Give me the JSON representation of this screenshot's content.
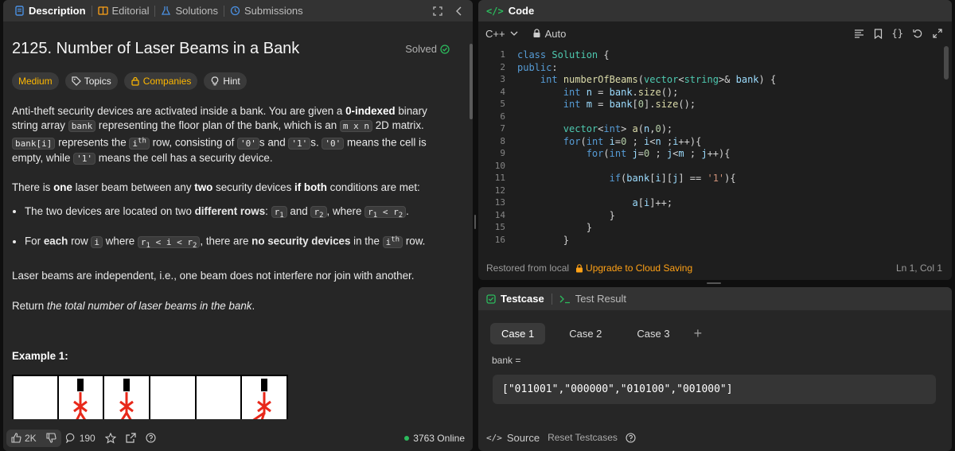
{
  "left_tabs": [
    {
      "label": "Description",
      "icon": "document-icon"
    },
    {
      "label": "Editorial",
      "icon": "book-icon"
    },
    {
      "label": "Solutions",
      "icon": "flask-icon"
    },
    {
      "label": "Submissions",
      "icon": "history-icon"
    }
  ],
  "problem": {
    "title": "2125. Number of Laser Beams in a Bank",
    "solved_label": "Solved",
    "tags": {
      "difficulty": "Medium",
      "topics": "Topics",
      "companies": "Companies",
      "hint": "Hint"
    },
    "p1": {
      "a": "Anti-theft security devices are activated inside a bank. You are given a ",
      "b": "0-indexed",
      "c": " binary string array ",
      "code1": "bank",
      "d": " representing the floor plan of the bank, which is an ",
      "code2": "m x n",
      "e": " 2D matrix. ",
      "code3": "bank[i]",
      "f": " represents the ",
      "code4": "i",
      "code4sup": "th",
      "g": " row, consisting of ",
      "code5": "'0'",
      "h": "s and ",
      "code6": "'1'",
      "i": "s. ",
      "code7": "'0'",
      "j": " means the cell is empty, while ",
      "code8": "'1'",
      "k": " means the cell has a security device."
    },
    "p2": {
      "a": "There is ",
      "b": "one",
      "c": " laser beam between any ",
      "d": "two",
      "e": " security devices ",
      "f": "if both",
      "g": " conditions are met:"
    },
    "cond1": {
      "a": "The two devices are located on two ",
      "b": "different rows",
      "c": ": ",
      "r1": "r",
      "s1": "1",
      "and": " and ",
      "r2": "r",
      "s2": "2",
      "where": ", where ",
      "r1b": "r",
      "s1b": "1",
      "lt": " < r",
      "s2b": "2",
      "end": "."
    },
    "cond2": {
      "a": "For ",
      "b": "each",
      "c": " row ",
      "code_i": "i",
      "d": " where ",
      "r1": "r",
      "s1": "1",
      "mid": " < i < r",
      "s2": "2",
      "e": ", there are ",
      "f": "no security devices",
      "g": " in the ",
      "code_ith": "i",
      "code_ith_sup": "th",
      "h": " row."
    },
    "p3": "Laser beams are independent, i.e., one beam does not interfere nor join with another.",
    "p4": {
      "a": "Return ",
      "b": "the total number of laser beams in the bank",
      "c": "."
    },
    "example_title": "Example 1:"
  },
  "bottom_bar": {
    "likes": "2K",
    "comments": "190",
    "online": "3763 Online"
  },
  "code_panel": {
    "title": "Code",
    "language": "C++",
    "mode": "Auto",
    "status_left": "Restored from local",
    "upgrade": "Upgrade to Cloud Saving",
    "cursor": "Ln 1, Col 1"
  },
  "code_lines": [
    "1",
    "2",
    "3",
    "4",
    "5",
    "6",
    "7",
    "8",
    "9",
    "10",
    "11",
    "12",
    "13",
    "14",
    "15",
    "16"
  ],
  "test_panel": {
    "tab_testcase": "Testcase",
    "tab_result": "Test Result",
    "cases": [
      "Case 1",
      "Case 2",
      "Case 3"
    ],
    "param_label": "bank =",
    "param_value": "[\"011001\",\"000000\",\"010100\",\"001000\"]",
    "source": "Source",
    "reset": "Reset Testcases"
  },
  "colors": {
    "accent_green": "#2cbb5d",
    "accent_orange": "#ffa116",
    "medium": "#ffb800"
  }
}
